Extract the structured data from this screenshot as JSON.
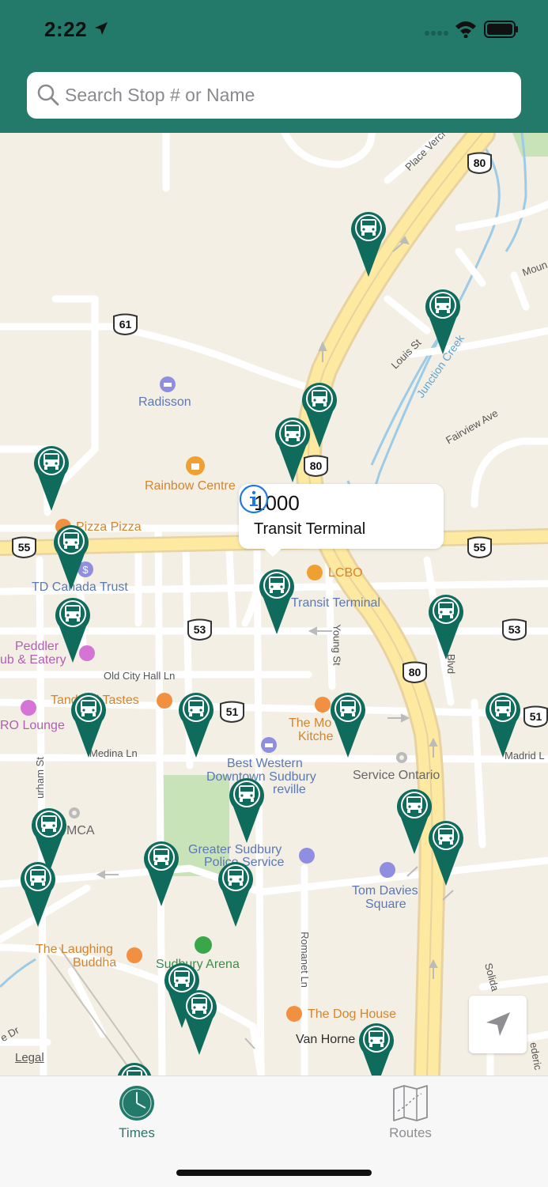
{
  "status_bar": {
    "time": "2:22"
  },
  "search": {
    "placeholder": "Search Stop # or Name"
  },
  "map": {
    "highway_shields": [
      "80",
      "61",
      "80",
      "55",
      "55",
      "53",
      "53",
      "80",
      "51",
      "51"
    ],
    "labels": {
      "radisson": "Radisson",
      "rainbow_centre": "Rainbow Centre",
      "pizza_pizza": "Pizza Pizza",
      "td_canada_trust": "TD Canada Trust",
      "lcbo": "LCBO",
      "transit_terminal": "Transit Terminal",
      "peddler_1": "Peddler",
      "peddler_2": "ub & Eatery",
      "old_city_hall": "Old City Hall Ln",
      "tandoori_tastes": "Tandoori Tastes",
      "ro_lounge": "RO Lounge",
      "the_mo_1": "The Mo",
      "the_mo_2": "Kitche",
      "medina_ln": "Medina Ln",
      "best_western_1": "Best Western",
      "best_western_2": "Downtown Sudbury",
      "best_western_3": "reville",
      "service_ontario": "Service Ontario",
      "madrid_ln": "Madrid L",
      "ymca": "MCA",
      "police_1": "Greater Sudbury",
      "police_2": "Police Service",
      "tom_davies_1": "Tom Davies",
      "tom_davies_2": "Square",
      "laughing_buddha_1": "The Laughing",
      "laughing_buddha_2": "Buddha",
      "sudbury_arena": "Sudbury Arena",
      "dog_house": "The Dog House",
      "van_horne": "Van Horne",
      "place_vercl": "Place Vercl",
      "louis_st": "Louis St",
      "junction_creek": "Junction Creek",
      "fairview_ave": "Fairview Ave",
      "young_st": "Young St",
      "durham_st": "urham St",
      "romanet_ln": "Romanet Ln",
      "blvd": "Blvd",
      "mount": "Moun",
      "solida": "Solida",
      "frederic": "ederic",
      "le_dr": "e Dr"
    }
  },
  "callout": {
    "stop_number": "1000",
    "stop_name": "Transit Terminal"
  },
  "legal_link": "Legal",
  "tabs": [
    {
      "label": "Times",
      "active": true
    },
    {
      "label": "Routes",
      "active": false
    }
  ],
  "colors": {
    "brand": "#237a6a",
    "pin": "#0f6b5c",
    "inactive_tab": "#8e8e93"
  }
}
